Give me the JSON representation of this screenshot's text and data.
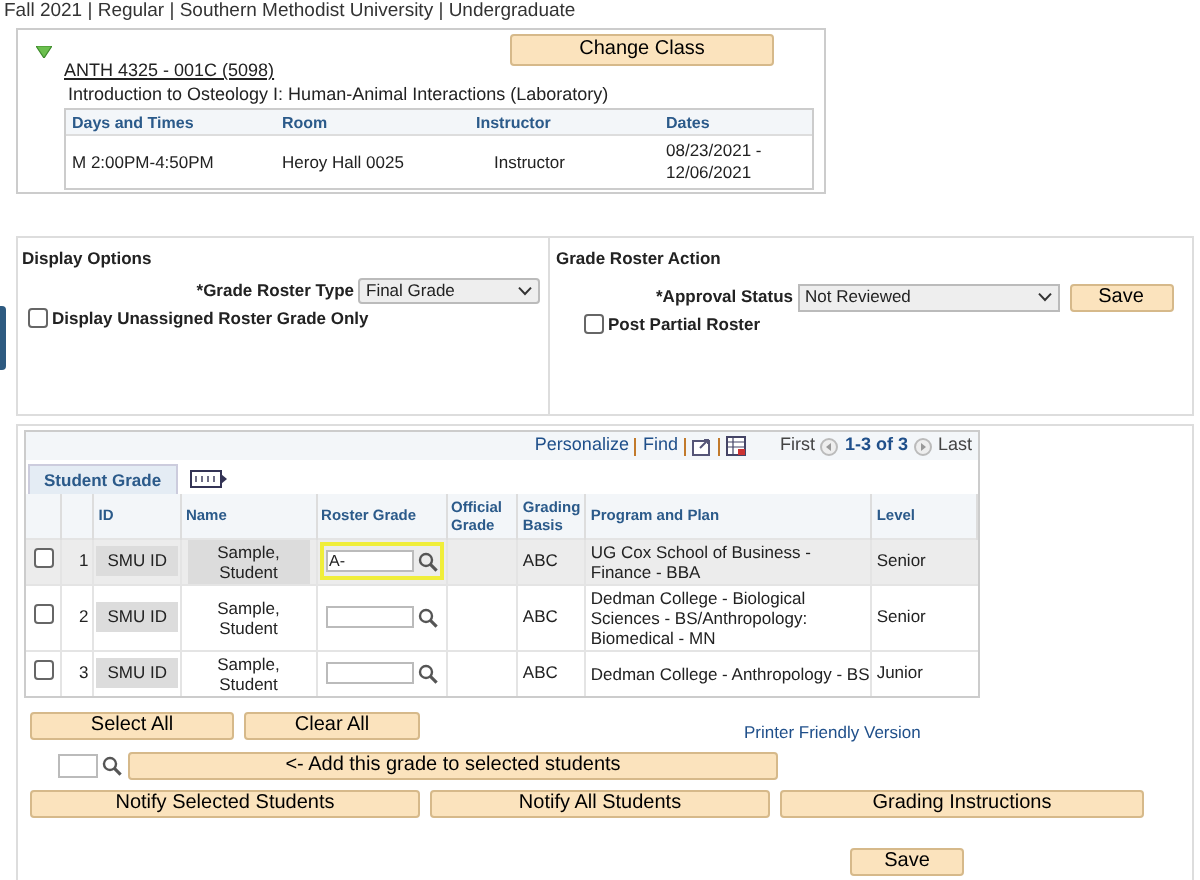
{
  "header": "Fall 2021 | Regular | Southern Methodist University | Undergraduate",
  "class_info": {
    "expanded": true,
    "change_button": "Change Class",
    "class_link": "ANTH 4325 - 001C (5098)",
    "title": "Introduction to Osteology I: Human-Animal Interactions (Laboratory)",
    "columns": [
      "Days and Times",
      "Room",
      "Instructor",
      "Dates"
    ],
    "row": [
      "M 2:00PM-4:50PM",
      "Heroy Hall 0025",
      "Instructor",
      "08/23/2021 - 12/06/2021"
    ]
  },
  "display_options": {
    "title": "Display Options",
    "roster_type_label": "*Grade Roster Type",
    "roster_type_value": "Final Grade",
    "unassigned_label": "Display Unassigned Roster Grade Only",
    "unassigned_checked": false
  },
  "roster_action": {
    "title": "Grade Roster Action",
    "approval_label": "*Approval Status",
    "approval_value": "Not Reviewed",
    "save": "Save",
    "post_partial_label": "Post Partial Roster",
    "post_partial_checked": false
  },
  "grid": {
    "links": [
      "Personalize",
      "Find"
    ],
    "first": "First",
    "range": "1-3 of 3",
    "last": "Last",
    "tab": "Student Grade",
    "columns": [
      "ID",
      "Name",
      "Roster Grade",
      "Official Grade",
      "Grading Basis",
      "Program and Plan",
      "Level"
    ],
    "rows": [
      {
        "checked": false,
        "number": "1",
        "id": "SMU ID",
        "name": "Sample, Student",
        "grade": "A-",
        "focused": true,
        "highlighted": true,
        "official": "",
        "basis": "ABC",
        "program": "UG Cox School of Business - Finance - BBA",
        "level": "Senior"
      },
      {
        "checked": false,
        "number": "2",
        "id": "SMU ID",
        "name": "Sample, Student",
        "grade": "",
        "focused": false,
        "highlighted": false,
        "official": "",
        "basis": "ABC",
        "program": "Dedman College - Biological Sciences - BS/Anthropology: Biomedical - MN",
        "level": "Senior"
      },
      {
        "checked": false,
        "number": "3",
        "id": "SMU ID",
        "name": "Sample, Student",
        "grade": "",
        "focused": false,
        "highlighted": false,
        "official": "",
        "basis": "ABC",
        "program": "Dedman College - Anthropology - BS",
        "level": "Junior"
      }
    ]
  },
  "select_all": "Select All",
  "clear_all": "Clear All",
  "printer_link": "Printer Friendly Version",
  "add_grade": "<- Add this grade to selected students",
  "notify_buttons": [
    "Notify Selected Students",
    "Notify All Students",
    "Grading Instructions"
  ],
  "save": "Save"
}
